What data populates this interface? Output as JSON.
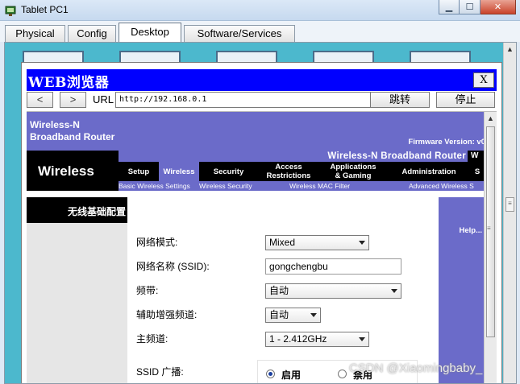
{
  "window": {
    "title": "Tablet PC1"
  },
  "tabs": [
    "Physical",
    "Config",
    "Desktop",
    "Software/Services"
  ],
  "active_tab": "Desktop",
  "browser": {
    "title": "WEB浏览器",
    "close_label": "X",
    "back_label": "<",
    "forward_label": ">",
    "url_label": "URL",
    "url_value": "http://192.168.0.1",
    "go_label": "跳转",
    "stop_label": "停止"
  },
  "router": {
    "brand_line1": "Wireless-N",
    "brand_line2": "Broadband Router",
    "firmware": "Firmware Version: v0",
    "section_title": "Wireless",
    "model_name": "Wireless-N Broadband Router",
    "model_tail": "W",
    "menu": [
      {
        "label": "Setup"
      },
      {
        "label": "Wireless"
      },
      {
        "label": "Security"
      },
      {
        "label": "Access\nRestrictions"
      },
      {
        "label": "Applications\n& Gaming"
      },
      {
        "label": "Administration"
      },
      {
        "label": "S"
      }
    ],
    "submenu": [
      "Basic Wireless Settings",
      "Wireless Security",
      "Wireless MAC Filter",
      "Advanced Wireless S"
    ],
    "sidebar_title": "无线基础配置",
    "help_label": "Help..."
  },
  "form": {
    "network_mode_label": "网络模式:",
    "network_mode_value": "Mixed",
    "ssid_label": "网络名称 (SSID):",
    "ssid_value": "gongchengbu",
    "band_label": "频带:",
    "band_value": "自动",
    "sideband_label": "辅助增强频道:",
    "sideband_value": "自动",
    "channel_label": "主频道:",
    "channel_value": "1 - 2.412GHz",
    "broadcast_label": "SSID 广播:",
    "broadcast_on": "启用",
    "broadcast_off": "禁用",
    "broadcast_selected": "on"
  },
  "watermark": "CSDN @Xiaomingbaby_"
}
